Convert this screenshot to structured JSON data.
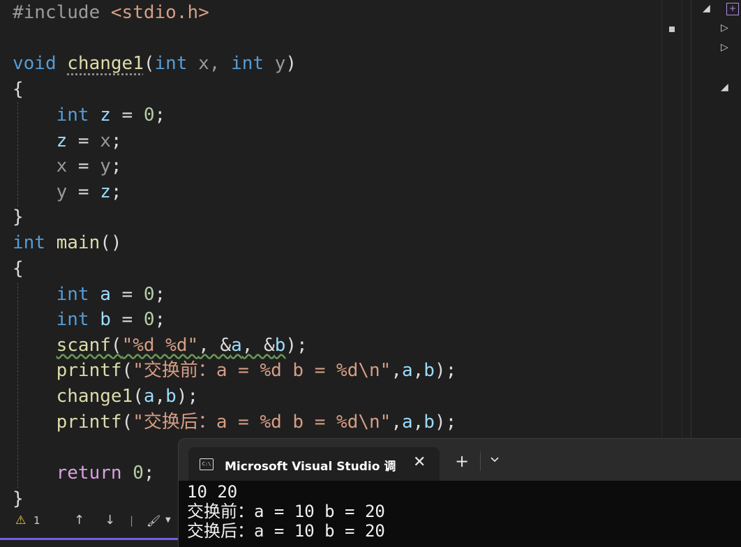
{
  "editor": {
    "lines": [
      {
        "id": "l1",
        "tokens": [
          {
            "t": "#include ",
            "c": "pp"
          },
          {
            "t": "<stdio.h>",
            "c": "hdr"
          }
        ]
      },
      {
        "id": "l2",
        "tokens": []
      },
      {
        "id": "l3",
        "tokens": [
          {
            "t": "void",
            "c": "kw"
          },
          {
            "t": " ",
            "c": "pl"
          },
          {
            "t": "change1",
            "c": "fn dots"
          },
          {
            "t": "(",
            "c": "pl"
          },
          {
            "t": "int",
            "c": "kw"
          },
          {
            "t": " x, ",
            "c": "param"
          },
          {
            "t": "int",
            "c": "kw"
          },
          {
            "t": " y",
            "c": "param"
          },
          {
            "t": ")",
            "c": "pl"
          }
        ]
      },
      {
        "id": "l4",
        "tokens": [
          {
            "t": "{",
            "c": "pl"
          }
        ]
      },
      {
        "id": "l5",
        "tokens": [
          {
            "t": "    ",
            "c": "pl"
          },
          {
            "t": "int",
            "c": "kw"
          },
          {
            "t": " ",
            "c": "pl"
          },
          {
            "t": "z",
            "c": "var"
          },
          {
            "t": " = ",
            "c": "pl"
          },
          {
            "t": "0",
            "c": "num"
          },
          {
            "t": ";",
            "c": "pl"
          }
        ]
      },
      {
        "id": "l6",
        "tokens": [
          {
            "t": "    ",
            "c": "pl"
          },
          {
            "t": "z",
            "c": "var"
          },
          {
            "t": " = ",
            "c": "pl"
          },
          {
            "t": "x",
            "c": "param"
          },
          {
            "t": ";",
            "c": "pl"
          }
        ]
      },
      {
        "id": "l7",
        "tokens": [
          {
            "t": "    ",
            "c": "pl"
          },
          {
            "t": "x",
            "c": "param"
          },
          {
            "t": " = ",
            "c": "pl"
          },
          {
            "t": "y",
            "c": "param"
          },
          {
            "t": ";",
            "c": "pl"
          }
        ]
      },
      {
        "id": "l8",
        "tokens": [
          {
            "t": "    ",
            "c": "pl"
          },
          {
            "t": "y",
            "c": "param"
          },
          {
            "t": " = ",
            "c": "pl"
          },
          {
            "t": "z",
            "c": "var"
          },
          {
            "t": ";",
            "c": "pl"
          }
        ]
      },
      {
        "id": "l9",
        "tokens": [
          {
            "t": "}",
            "c": "pl"
          }
        ]
      },
      {
        "id": "l10",
        "tokens": [
          {
            "t": "int",
            "c": "kw"
          },
          {
            "t": " ",
            "c": "pl"
          },
          {
            "t": "main",
            "c": "fn"
          },
          {
            "t": "()",
            "c": "pl"
          }
        ]
      },
      {
        "id": "l11",
        "tokens": [
          {
            "t": "{",
            "c": "pl"
          }
        ]
      },
      {
        "id": "l12",
        "tokens": [
          {
            "t": "    ",
            "c": "pl"
          },
          {
            "t": "int",
            "c": "kw"
          },
          {
            "t": " ",
            "c": "pl"
          },
          {
            "t": "a",
            "c": "var"
          },
          {
            "t": " = ",
            "c": "pl"
          },
          {
            "t": "0",
            "c": "num"
          },
          {
            "t": ";",
            "c": "pl"
          }
        ]
      },
      {
        "id": "l13",
        "tokens": [
          {
            "t": "    ",
            "c": "pl"
          },
          {
            "t": "int",
            "c": "kw"
          },
          {
            "t": " ",
            "c": "pl"
          },
          {
            "t": "b",
            "c": "var"
          },
          {
            "t": " = ",
            "c": "pl"
          },
          {
            "t": "0",
            "c": "num"
          },
          {
            "t": ";",
            "c": "pl"
          }
        ]
      },
      {
        "id": "l14",
        "tokens": [
          {
            "t": "    ",
            "c": "pl"
          },
          {
            "t": "scanf",
            "c": "fn squiggle"
          },
          {
            "t": "(",
            "c": "pl squiggle"
          },
          {
            "t": "\"%d %d\"",
            "c": "str squiggle"
          },
          {
            "t": ", &",
            "c": "pl squiggle"
          },
          {
            "t": "a",
            "c": "var squiggle"
          },
          {
            "t": ", &",
            "c": "pl squiggle"
          },
          {
            "t": "b",
            "c": "var squiggle"
          },
          {
            "t": ");",
            "c": "pl"
          }
        ]
      },
      {
        "id": "l15",
        "tokens": [
          {
            "t": "    ",
            "c": "pl"
          },
          {
            "t": "printf",
            "c": "fn"
          },
          {
            "t": "(",
            "c": "pl"
          },
          {
            "t": "\"交换前：a = %d b = %d\\n\"",
            "c": "str"
          },
          {
            "t": ",",
            "c": "pl"
          },
          {
            "t": "a",
            "c": "var"
          },
          {
            "t": ",",
            "c": "pl"
          },
          {
            "t": "b",
            "c": "var"
          },
          {
            "t": ");",
            "c": "pl"
          }
        ]
      },
      {
        "id": "l16",
        "tokens": [
          {
            "t": "    ",
            "c": "pl"
          },
          {
            "t": "change1",
            "c": "fn"
          },
          {
            "t": "(",
            "c": "pl"
          },
          {
            "t": "a",
            "c": "var"
          },
          {
            "t": ",",
            "c": "pl"
          },
          {
            "t": "b",
            "c": "var"
          },
          {
            "t": ");",
            "c": "pl"
          }
        ]
      },
      {
        "id": "l17",
        "tokens": [
          {
            "t": "    ",
            "c": "pl"
          },
          {
            "t": "printf",
            "c": "fn"
          },
          {
            "t": "(",
            "c": "pl"
          },
          {
            "t": "\"交换后：a = %d b = %d\\n\"",
            "c": "str"
          },
          {
            "t": ",",
            "c": "pl"
          },
          {
            "t": "a",
            "c": "var"
          },
          {
            "t": ",",
            "c": "pl"
          },
          {
            "t": "b",
            "c": "var"
          },
          {
            "t": ");",
            "c": "pl"
          }
        ]
      },
      {
        "id": "l18",
        "tokens": []
      },
      {
        "id": "l19",
        "tokens": [
          {
            "t": "    ",
            "c": "pl"
          },
          {
            "t": "return",
            "c": "ctl"
          },
          {
            "t": " ",
            "c": "pl"
          },
          {
            "t": "0",
            "c": "num"
          },
          {
            "t": ";",
            "c": "pl"
          }
        ]
      },
      {
        "id": "l20",
        "tokens": [
          {
            "t": "}",
            "c": "pl"
          }
        ]
      }
    ]
  },
  "status_bar": {
    "warning_icon": "warning-icon",
    "warning_count": "1",
    "up_icon": "arrow-up-icon",
    "down_icon": "arrow-down-icon",
    "brush_icon": "brush-icon"
  },
  "console": {
    "tab_title": "Microsoft Visual Studio 调试控",
    "tab_icon": "C:\\",
    "close_glyph": "✕",
    "new_tab_glyph": "+",
    "dropdown_glyph": "⌄",
    "output": [
      "10 20",
      "交换前：a = 10 b = 20",
      "交换后：a = 10 b = 20"
    ]
  },
  "colors": {
    "editor_bg": "#1f1f1f",
    "keyword": "#569cd6",
    "function": "#dcdcaa",
    "variable": "#9cdcfe",
    "number": "#b5cea8",
    "string": "#d69d85",
    "control": "#d8a0df",
    "console_bg": "#0c0c0c",
    "accent": "#7160e8"
  }
}
